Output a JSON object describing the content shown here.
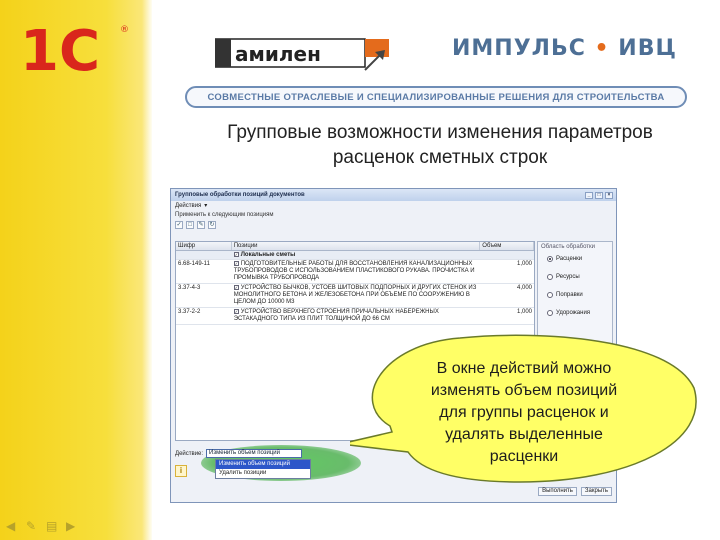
{
  "brand": {
    "logo_1c": "1С",
    "logo_amilen": "амилен",
    "logo_impuls_left": "ИМПУЛЬС",
    "logo_impuls_sep": "•",
    "logo_impuls_right": "ИВЦ",
    "banner": "СОВМЕСТНЫЕ ОТРАСЛЕВЫЕ И СПЕЦИАЛИЗИРОВАННЫЕ РЕШЕНИЯ ДЛЯ СТРОИТЕЛЬСТВА"
  },
  "slide": {
    "title_line1": "Групповые возможности изменения параметров",
    "title_line2": "расценок сметных строк"
  },
  "window": {
    "title": "Групповые обработки позиций документов",
    "menu_actions": "Действия",
    "apply_label": "Применить к следующим позициям",
    "columns": {
      "code": "Шифр",
      "positions": "Позиции",
      "volume": "Объем"
    },
    "rows": [
      {
        "code": "",
        "name": "Локальные сметы",
        "volume": "",
        "group": true
      },
      {
        "code": "6.68-149-11",
        "name": "ПОДГОТОВИТЕЛЬНЫЕ РАБОТЫ ДЛЯ ВОССТАНОВЛЕНИЯ КАНАЛИЗАЦИОННЫХ ТРУБОПРОВОДОВ С ИСПОЛЬЗОВАНИЕМ ПЛАСТИКОВОГО РУКАВА. ПРОЧИСТКА И ПРОМЫВКА ТРУБОПРОВОДА",
        "volume": "1,000",
        "group": false
      },
      {
        "code": "3.37-4-3",
        "name": "УСТРОЙСТВО БЫЧКОВ, УСТОЕВ ШИТОВЫХ ПОДПОРНЫХ И ДРУГИХ СТЕНОК ИЗ МОНОЛИТНОГО БЕТОНА И ЖЕЛЕЗОБЕТОНА ПРИ ОБЪЕМЕ ПО СООРУЖЕНИЮ В ЦЕЛОМ ДО 10000 М3",
        "volume": "4,000",
        "group": false
      },
      {
        "code": "3.37-2-2",
        "name": "УСТРОЙСТВО ВЕРХНЕГО СТРОЕНИЯ ПРИЧАЛЬНЫХ НАБЕРЕЖНЫХ ЭСТАКАДНОГО ТИПА ИЗ ПЛИТ ТОЛЩИНОЙ ДО 66 СМ",
        "volume": "1,000",
        "group": false
      }
    ],
    "scope": {
      "title": "Область обработки",
      "options": [
        {
          "label": "Расценки",
          "selected": true
        },
        {
          "label": "Ресурсы",
          "selected": false
        },
        {
          "label": "Поправки",
          "selected": false
        },
        {
          "label": "Удорожания",
          "selected": false
        }
      ]
    },
    "action_label": "Действие:",
    "action_selected": "Изменить объем позиций",
    "action_options": [
      "Изменить объем позиций",
      "Удалить позиции"
    ],
    "info_icon_text": "i",
    "btn_execute": "Выполнить",
    "btn_close": "Закрыть"
  },
  "callout": {
    "line1": "В окне действий можно",
    "line2": "изменять объем позиций",
    "line3": "для группы расценок и",
    "line4": "удалять выделенные",
    "line5": "расценки"
  },
  "colors": {
    "accent_yellow": "#f4d21a",
    "brand_red": "#d9261c",
    "brand_blue": "#4d6f95",
    "callout_fill": "#ffff66"
  }
}
